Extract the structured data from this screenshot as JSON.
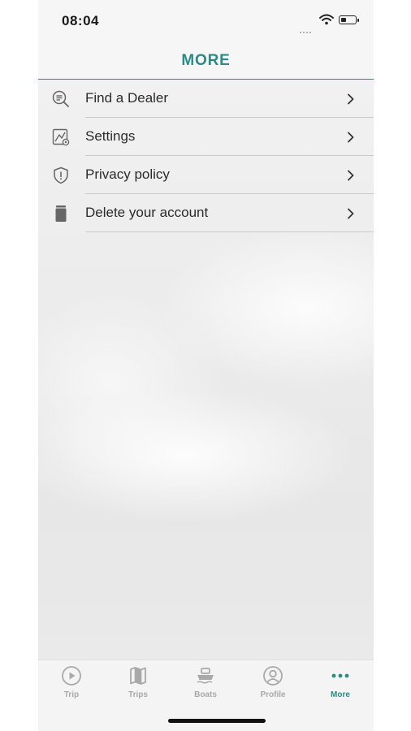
{
  "status_bar": {
    "time": "08:04"
  },
  "header": {
    "title": "MORE"
  },
  "menu": {
    "items": [
      {
        "label": "Find a Dealer",
        "icon": "search-list-icon"
      },
      {
        "label": "Settings",
        "icon": "settings-icon"
      },
      {
        "label": "Privacy policy",
        "icon": "shield-icon"
      },
      {
        "label": "Delete your account",
        "icon": "trash-icon"
      }
    ]
  },
  "tabbar": {
    "tabs": [
      {
        "label": "Trip",
        "icon": "play-circle-icon",
        "active": false
      },
      {
        "label": "Trips",
        "icon": "map-icon",
        "active": false
      },
      {
        "label": "Boats",
        "icon": "boat-icon",
        "active": false
      },
      {
        "label": "Profile",
        "icon": "profile-icon",
        "active": false
      },
      {
        "label": "More",
        "icon": "more-dots-icon",
        "active": true
      }
    ]
  },
  "colors": {
    "accent": "#2d8b86",
    "inactive": "#a9a9a9"
  }
}
